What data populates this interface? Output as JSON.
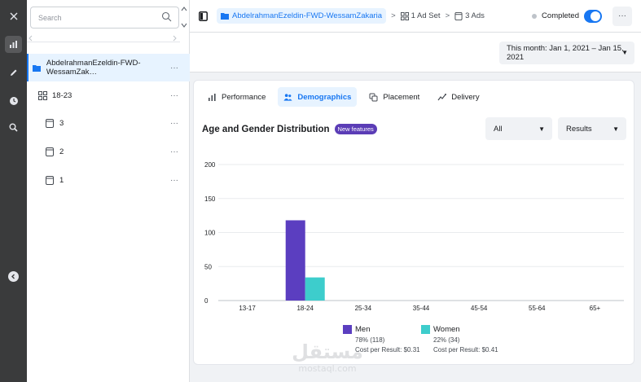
{
  "rail": {
    "items": [
      {
        "icon": "close-icon",
        "active": false
      },
      {
        "icon": "bar-chart-icon",
        "active": true
      },
      {
        "icon": "pencil-icon",
        "active": false
      },
      {
        "icon": "clock-icon",
        "active": false
      },
      {
        "icon": "search-zoom-icon",
        "active": false
      }
    ]
  },
  "search": {
    "placeholder": "Search"
  },
  "tree": {
    "items": [
      {
        "label": "AbdelrahmanEzeldin-FWD-WessamZak…",
        "icon": "folder-icon",
        "more": "···"
      },
      {
        "label": "18-23",
        "icon": "ad-set-icon",
        "more": "···"
      },
      {
        "label": "3",
        "icon": "ad-icon",
        "more": "···"
      },
      {
        "label": "2",
        "icon": "ad-icon",
        "more": "···"
      },
      {
        "label": "1",
        "icon": "ad-icon",
        "more": "···"
      }
    ]
  },
  "breadcrumb": {
    "campaign": "AbdelrahmanEzeldin-FWD-WessamZakaria",
    "ad_set": "1 Ad Set",
    "ads": "3 Ads",
    "separator": ">"
  },
  "status": {
    "label": "Completed",
    "toggle_on": true
  },
  "more_label": "···",
  "date_range": {
    "label": "This month: Jan 1, 2021 – Jan 15, 2021"
  },
  "tabs": [
    {
      "label": "Performance",
      "icon": "bar-chart-icon",
      "active": false
    },
    {
      "label": "Demographics",
      "icon": "people-icon",
      "active": true
    },
    {
      "label": "Placement",
      "icon": "placement-icon",
      "active": false
    },
    {
      "label": "Delivery",
      "icon": "delivery-icon",
      "active": false
    }
  ],
  "card": {
    "title": "Age and Gender Distribution",
    "badge": "New features",
    "filter_all": "All",
    "filter_metric": "Results"
  },
  "colors": {
    "men": "#5b3ec0",
    "women": "#3dcdcc",
    "accent": "#1877f2"
  },
  "chart_data": {
    "type": "bar",
    "categories": [
      "13-17",
      "18-24",
      "25-34",
      "35-44",
      "45-54",
      "55-64",
      "65+"
    ],
    "series": [
      {
        "name": "Men",
        "values": [
          0,
          118,
          0,
          0,
          0,
          0,
          0
        ]
      },
      {
        "name": "Women",
        "values": [
          0,
          34,
          0,
          0,
          0,
          0,
          0
        ]
      }
    ],
    "y_ticks": [
      "200",
      "150",
      "100",
      "50",
      "0"
    ],
    "ylim": [
      0,
      200
    ],
    "grid": true,
    "legend": [
      {
        "name": "Men",
        "share": "78% (118)",
        "cost": "Cost per Result: $0.31"
      },
      {
        "name": "Women",
        "share": "22% (34)",
        "cost": "Cost per Result: $0.41"
      }
    ]
  },
  "watermark": {
    "arabic": "مستقل",
    "latin": "mostaql.com"
  }
}
